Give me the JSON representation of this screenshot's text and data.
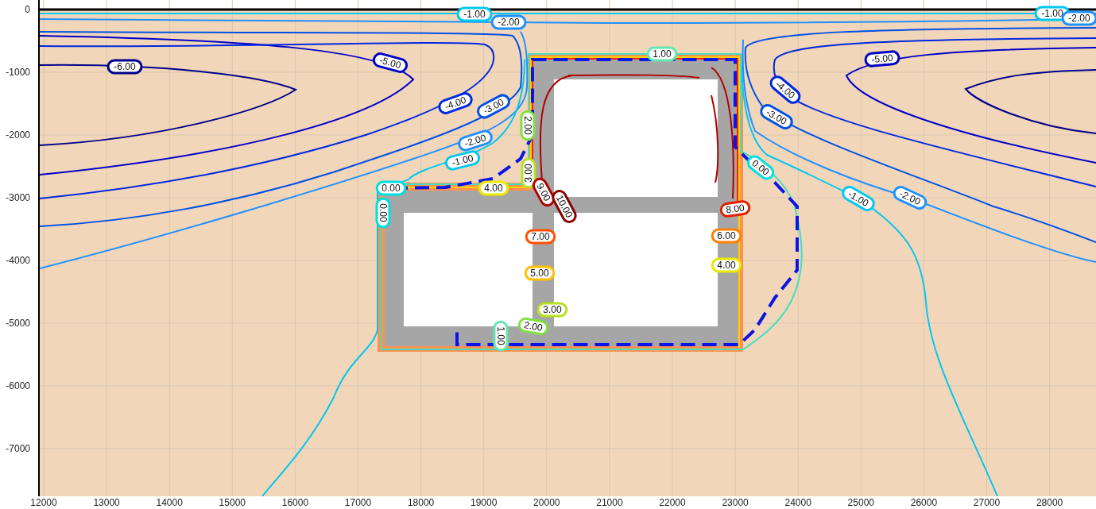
{
  "plot": {
    "y_axis": {
      "ticks": [
        "0",
        "-1000",
        "-2000",
        "-3000",
        "-4000",
        "-5000",
        "-6000",
        "-7000"
      ]
    },
    "x_axis": {
      "ticks": [
        "12000",
        "13000",
        "14000",
        "15000",
        "16000",
        "17000",
        "18000",
        "19000",
        "20000",
        "21000",
        "22000",
        "23000",
        "24000",
        "25000",
        "26000",
        "27000",
        "28000"
      ]
    },
    "contour_labels": [
      {
        "text": "-1.00",
        "color": "#00c8f0"
      },
      {
        "text": "-2.00",
        "color": "#1e90ff"
      },
      {
        "text": "-1.00",
        "color": "#00c8f0"
      },
      {
        "text": "-2.00",
        "color": "#1e90ff"
      },
      {
        "text": "-6.00",
        "color": "#00008b"
      },
      {
        "text": "-5.00",
        "color": "#0000c8"
      },
      {
        "text": "1.00",
        "color": "#60e8b0"
      },
      {
        "text": "-5.00",
        "color": "#0000c8"
      },
      {
        "text": "-4.00",
        "color": "#0028e0"
      },
      {
        "text": "-3.00",
        "color": "#0050e6"
      },
      {
        "text": "-4.00",
        "color": "#0028e0"
      },
      {
        "text": "-3.00",
        "color": "#0050e6"
      },
      {
        "text": "2.00",
        "color": "#80e040"
      },
      {
        "text": "-2.00",
        "color": "#1e90ff"
      },
      {
        "text": "-1.00",
        "color": "#00c8f0"
      },
      {
        "text": "3.00",
        "color": "#b8e020"
      },
      {
        "text": "0.00",
        "color": "#00e0e0"
      },
      {
        "text": "0.00",
        "color": "#00e0e0"
      },
      {
        "text": "4.00",
        "color": "#e8e800"
      },
      {
        "text": "9.00",
        "color": "#b00000"
      },
      {
        "text": "10.00",
        "color": "#8b0000"
      },
      {
        "text": "-1.00",
        "color": "#00c8f0"
      },
      {
        "text": "-2.00",
        "color": "#1e90ff"
      },
      {
        "text": "0.00",
        "color": "#00e0e0"
      },
      {
        "text": "8.00",
        "color": "#e02000"
      },
      {
        "text": "7.00",
        "color": "#ff5000"
      },
      {
        "text": "6.00",
        "color": "#ff8000"
      },
      {
        "text": "4.00",
        "color": "#e8e800"
      },
      {
        "text": "5.00",
        "color": "#ffc000"
      },
      {
        "text": "3.00",
        "color": "#b8e020"
      },
      {
        "text": "2.00",
        "color": "#80e040"
      },
      {
        "text": "1.00",
        "color": "#60e8b0"
      }
    ]
  }
}
